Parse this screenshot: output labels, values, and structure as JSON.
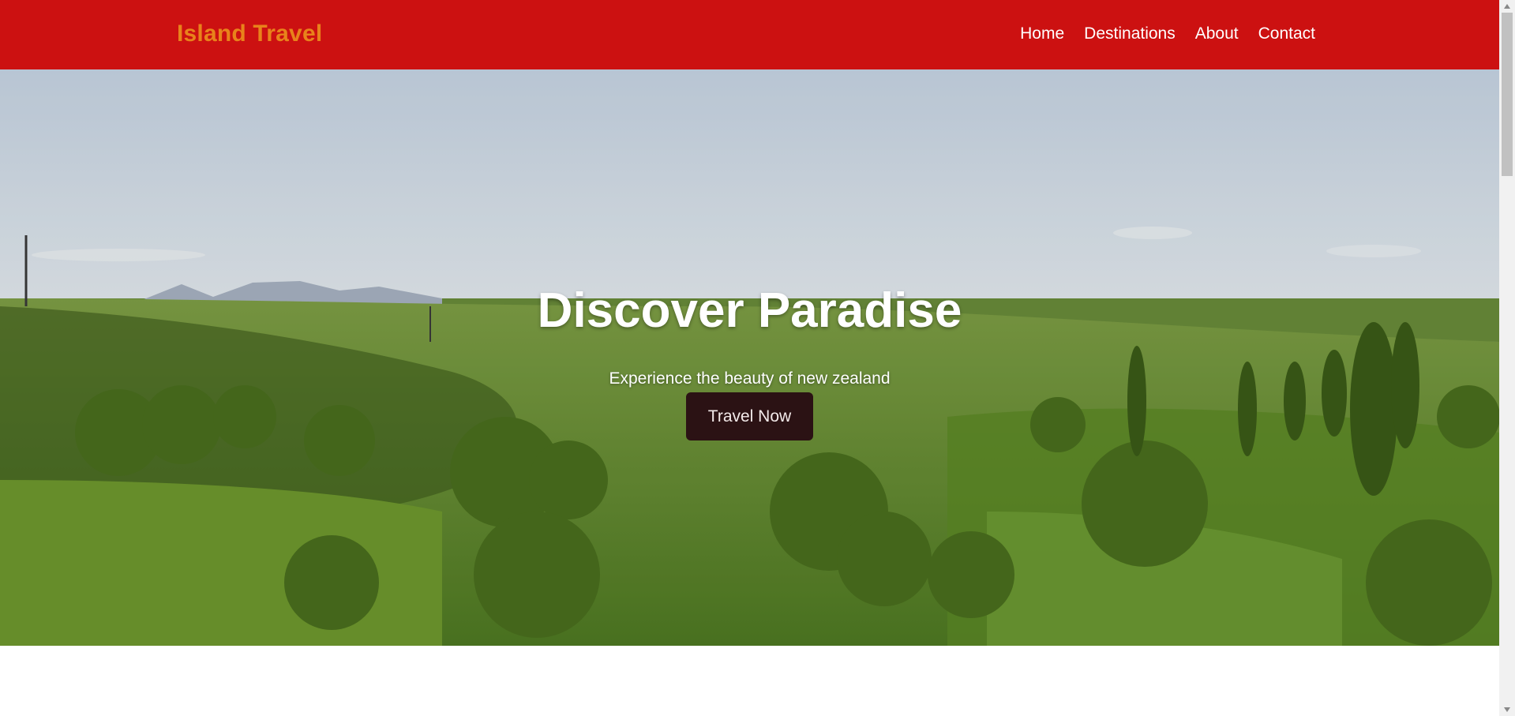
{
  "header": {
    "logo": "Island Travel",
    "nav": [
      "Home",
      "Destinations",
      "About",
      "Contact"
    ]
  },
  "hero": {
    "title": "Discover Paradise",
    "subtitle": "Experience the beauty of new zealand",
    "cta_label": "Travel Now",
    "image_alt_icon": "landscape-image"
  },
  "colors": {
    "header_bg": "#cc1111",
    "logo": "#e8831b",
    "button_bg": "#2b1214"
  }
}
